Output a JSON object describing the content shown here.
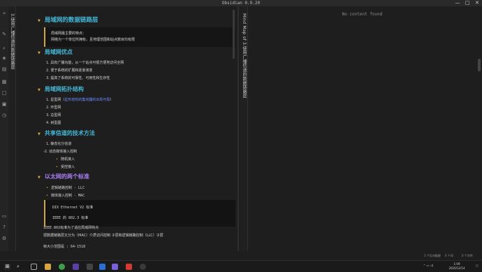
{
  "window": {
    "title": "Obsidian 0.9.20",
    "minimize": "—",
    "maximize": "□",
    "close": "✕"
  },
  "left_tab": {
    "label": "3.使用广播信道的数据链路层"
  },
  "right_tab": {
    "label": "Mind Map of 3.使用广播信道的数据链路层"
  },
  "right_pane": {
    "empty_text": "No content found"
  },
  "note": {
    "h1": "局域网的数据链路层",
    "callout": [
      "局域网最主要的特点：",
      "网络为一个单位所拥有，且地理范围和站点数目均有限"
    ],
    "sec_advantages": "局域网优点",
    "advantages": [
      "1.  具有广播功能，从一个站点可很方便地访问全网",
      "2.  便于系统的扩展和逐渐演变",
      "3.  提高了系统的可靠性、可用性和生存性"
    ],
    "sec_topology": "局域网拓扑结构",
    "topology_1_prefix": "1.  星型网（",
    "topology_1_hl": "星形结构的集线器的出现可靠",
    "topology_1_suffix": "）",
    "topology": [
      "2.  环型网",
      "3.  总型网",
      "4.  树型图"
    ],
    "sec_shared": "共享信道的技术方法",
    "shared": [
      "1.  静态化分信道",
      "-2.  动态媒体接入控制"
    ],
    "shared_sub": [
      "随机接入",
      "受控接入"
    ],
    "sec_ethernet": "以太网的两个标准",
    "ethernet_bullets": [
      "逻辑链路控制 - LLC",
      "媒体接入控制 - MAC"
    ],
    "code": [
      "DIX Ethernet V2 标准",
      "IEEE 的 802.3 标准"
    ],
    "para1": "IEEE 802标准为了适应局域网特点",
    "para2": "把数据链路层又分为（MAC）介质访问控制 子层和逻辑链路控制（LLC）子层",
    "para3": "帧大小范围是 : 64-1518"
  },
  "status": {
    "backlinks": "1 个反向链接",
    "words": "0 个词",
    "chars": "0 个字符",
    "links": "个反向链接"
  },
  "taskbar": {
    "time": "1:09",
    "date": "2020/12/14"
  },
  "colors": {
    "heading": "#43b8d7",
    "heading_purple": "#a77ff0",
    "accent": "#d0a83c"
  }
}
